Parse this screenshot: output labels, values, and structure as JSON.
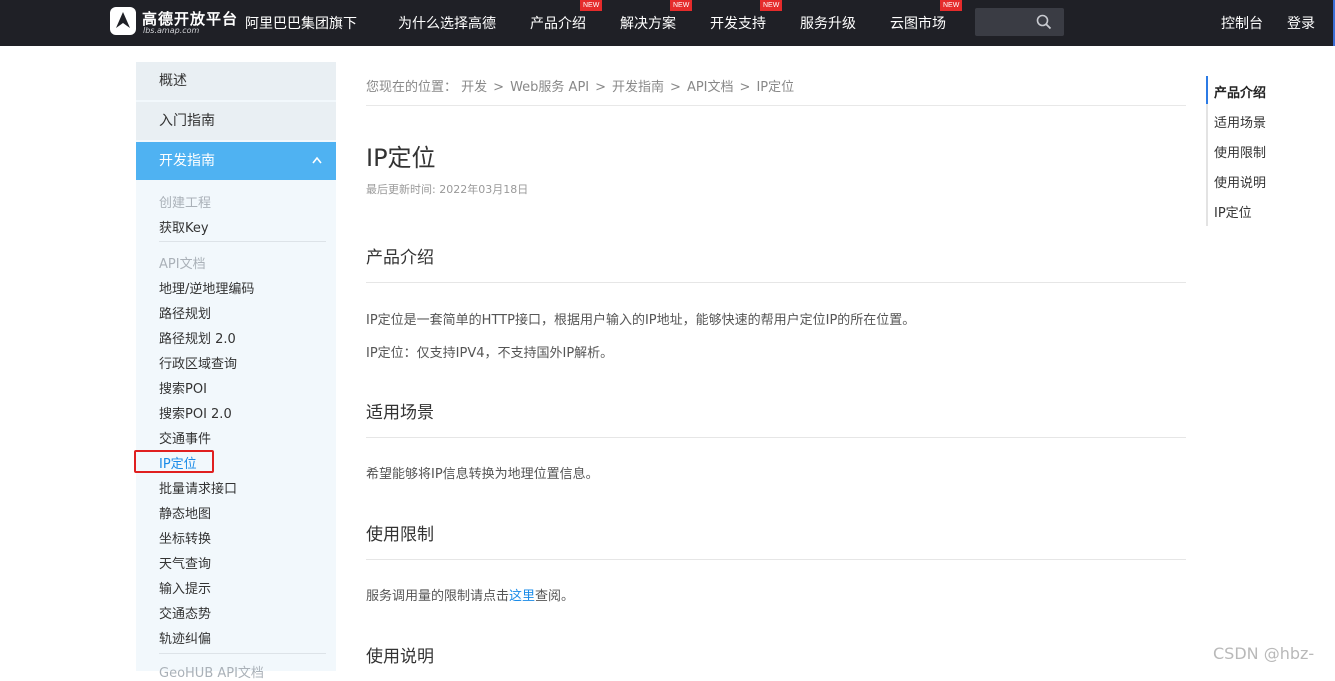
{
  "header": {
    "logo_title": "高德开放平台",
    "logo_sub": "lbs.amap.com",
    "brand_tag": "阿里巴巴集团旗下",
    "nav": [
      {
        "label": "为什么选择高德",
        "badge": ""
      },
      {
        "label": "产品介绍",
        "badge": "NEW"
      },
      {
        "label": "解决方案",
        "badge": "NEW"
      },
      {
        "label": "开发支持",
        "badge": "NEW"
      },
      {
        "label": "服务升级",
        "badge": ""
      },
      {
        "label": "云图市场",
        "badge": "NEW"
      }
    ],
    "search_placeholder": "",
    "console": "控制台",
    "login": "登录"
  },
  "sidebar": {
    "top_items": [
      "概述",
      "入门指南"
    ],
    "active_section": "开发指南",
    "group1_title": "创建工程",
    "group1_links": [
      "获取Key"
    ],
    "group2_title": "API文档",
    "group2_links": [
      "地理/逆地理编码",
      "路径规划",
      "路径规划 2.0",
      "行政区域查询",
      "搜索POI",
      "搜索POI 2.0",
      "交通事件",
      "IP定位",
      "批量请求接口",
      "静态地图",
      "坐标转换",
      "天气查询",
      "输入提示",
      "交通态势",
      "轨迹纠偏"
    ],
    "group3_title": "GeoHUB API文档",
    "current": "IP定位"
  },
  "main": {
    "breadcrumb_prefix": "您现在的位置：",
    "breadcrumb": [
      "开发",
      "Web服务 API",
      "开发指南",
      "API文档",
      "IP定位"
    ],
    "breadcrumb_sep": ">",
    "title": "IP定位",
    "updated": "最后更新时间: 2022年03月18日",
    "sections": {
      "intro": {
        "title": "产品介绍",
        "p1": "IP定位是一套简单的HTTP接口，根据用户输入的IP地址，能够快速的帮用户定位IP的所在位置。",
        "p2": "IP定位：仅支持IPV4，不支持国外IP解析。"
      },
      "scene": {
        "title": "适用场景",
        "p1": "希望能够将IP信息转换为地理位置信息。"
      },
      "limit": {
        "title": "使用限制",
        "p1_before": "服务调用量的限制请点击",
        "p1_link": "这里",
        "p1_after": "查阅。"
      },
      "usage": {
        "title": "使用说明"
      }
    }
  },
  "toc": {
    "items": [
      "产品介绍",
      "适用场景",
      "使用限制",
      "使用说明",
      "IP定位"
    ],
    "active": "产品介绍"
  },
  "watermark": "CSDN @hbz-",
  "colors": {
    "topbar": "#1f2026",
    "sidebar_active": "#4fb2f2",
    "link": "#1a8be8",
    "badge": "#e52b2b",
    "highlight_box": "#e02020"
  }
}
